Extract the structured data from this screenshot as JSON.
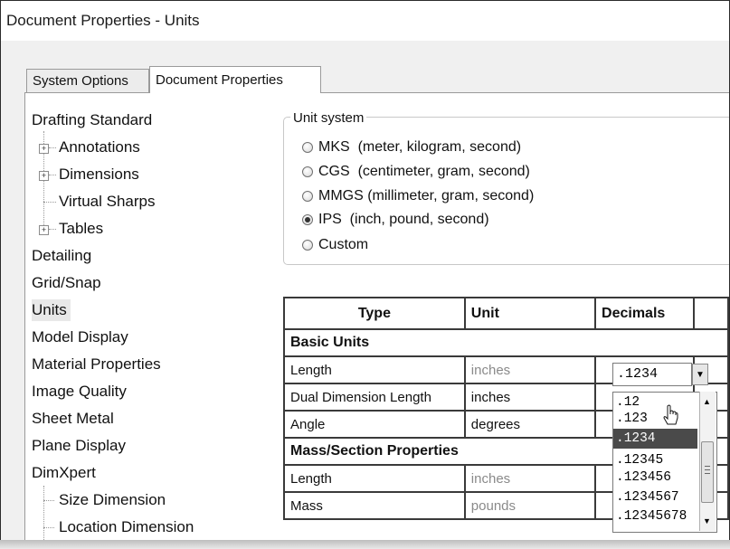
{
  "window": {
    "title": "Document Properties - Units"
  },
  "tabs": [
    {
      "label": "System Options",
      "active": false
    },
    {
      "label": "Document Properties",
      "active": true
    }
  ],
  "tree": [
    {
      "label": "Drafting Standard",
      "level": 0,
      "expander": false
    },
    {
      "label": "Annotations",
      "level": 1,
      "expander": true
    },
    {
      "label": "Dimensions",
      "level": 1,
      "expander": true
    },
    {
      "label": "Virtual Sharps",
      "level": 1,
      "expander": false
    },
    {
      "label": "Tables",
      "level": 1,
      "expander": true
    },
    {
      "label": "Detailing",
      "level": 0
    },
    {
      "label": "Grid/Snap",
      "level": 0
    },
    {
      "label": "Units",
      "level": 0,
      "selected": true
    },
    {
      "label": "Model Display",
      "level": 0
    },
    {
      "label": "Material Properties",
      "level": 0
    },
    {
      "label": "Image Quality",
      "level": 0
    },
    {
      "label": "Sheet Metal",
      "level": 0
    },
    {
      "label": "Plane Display",
      "level": 0
    },
    {
      "label": "DimXpert",
      "level": 0
    },
    {
      "label": "Size Dimension",
      "level": 1
    },
    {
      "label": "Location Dimension",
      "level": 1
    }
  ],
  "unit_system": {
    "legend": "Unit system",
    "options": [
      {
        "label": "MKS  (meter, kilogram, second)",
        "checked": false
      },
      {
        "label": "CGS  (centimeter, gram, second)",
        "checked": false
      },
      {
        "label": "MMGS (millimeter, gram, second)",
        "checked": false
      },
      {
        "label": "IPS  (inch, pound, second)",
        "checked": true
      },
      {
        "label": "Custom",
        "checked": false
      }
    ]
  },
  "table": {
    "headers": [
      "Type",
      "Unit",
      "Decimals"
    ],
    "section_basic": "Basic Units",
    "rows_basic": [
      {
        "type": "Length",
        "unit": "inches",
        "decimals": ".1234"
      },
      {
        "type": "Dual Dimension Length",
        "unit": "inches",
        "decimals": ""
      },
      {
        "type": "Angle",
        "unit": "degrees",
        "decimals": ""
      }
    ],
    "section_mass": "Mass/Section Properties",
    "rows_mass": [
      {
        "type": "Length",
        "unit": "inches"
      },
      {
        "type": "Mass",
        "unit": "pounds"
      }
    ]
  },
  "decimals_dropdown": {
    "selected": ".1234",
    "options": [
      ".12",
      ".123",
      ".1234",
      ".12345",
      ".123456",
      ".1234567",
      ".12345678"
    ],
    "highlighted": ".1234"
  }
}
